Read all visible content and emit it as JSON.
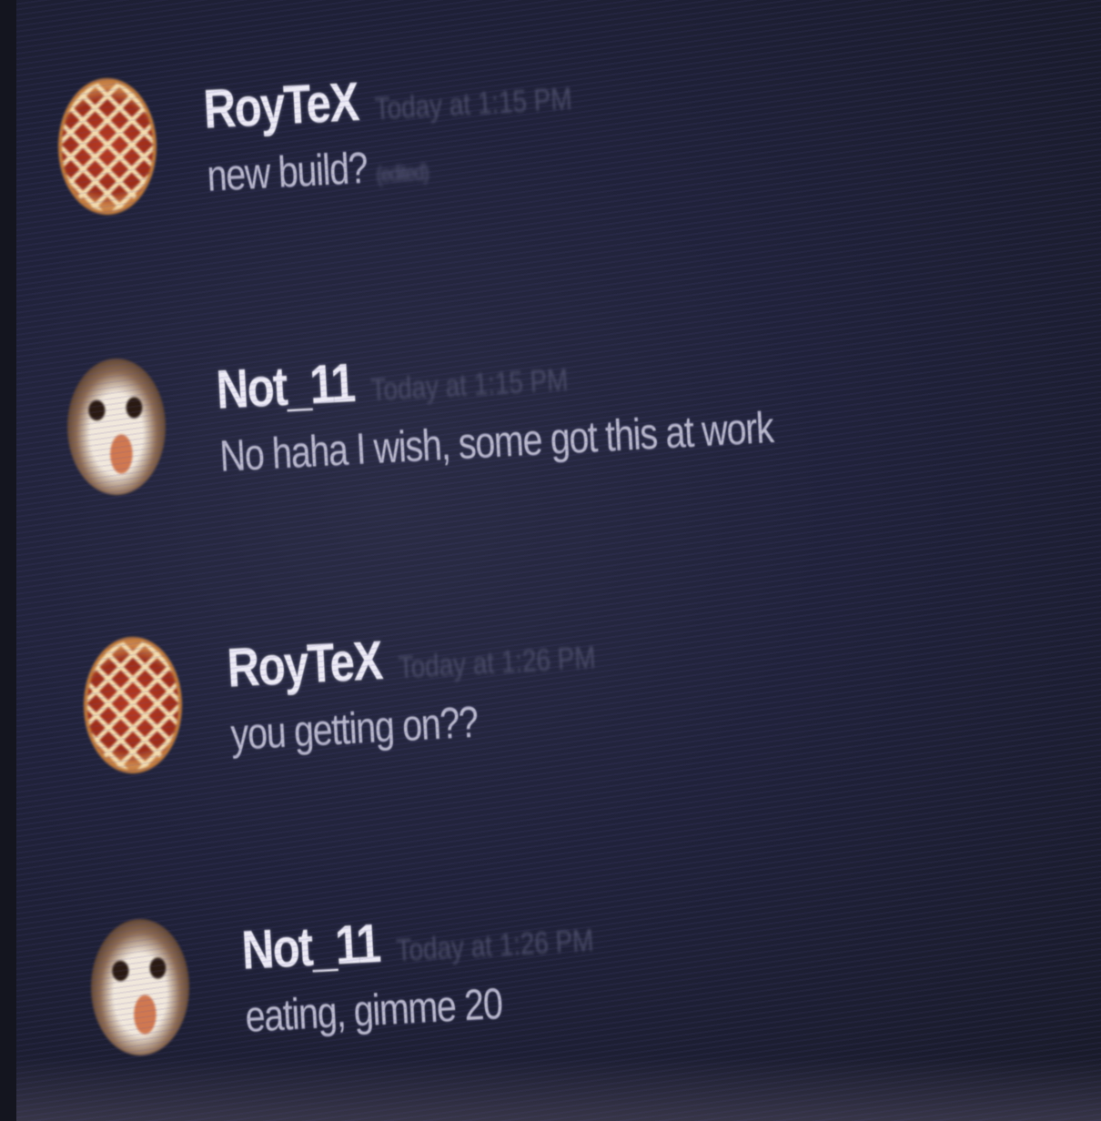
{
  "messages": [
    {
      "username": "RoyTeX",
      "timestamp": "Today at 1:15 PM",
      "text": "new build?",
      "edited": "(edited)",
      "avatar": "pie-avatar"
    },
    {
      "username": "Not_11",
      "timestamp": "Today at 1:15 PM",
      "text": "No haha I wish, some got this at work",
      "edited": "",
      "avatar": "sloth-avatar"
    },
    {
      "username": "RoyTeX",
      "timestamp": "Today at 1:26 PM",
      "text": "you getting on??",
      "edited": "",
      "avatar": "pie-avatar"
    },
    {
      "username": "Not_11",
      "timestamp": "Today at 1:26 PM",
      "text": "eating, gimme 20",
      "edited": "",
      "avatar": "sloth-avatar"
    }
  ]
}
